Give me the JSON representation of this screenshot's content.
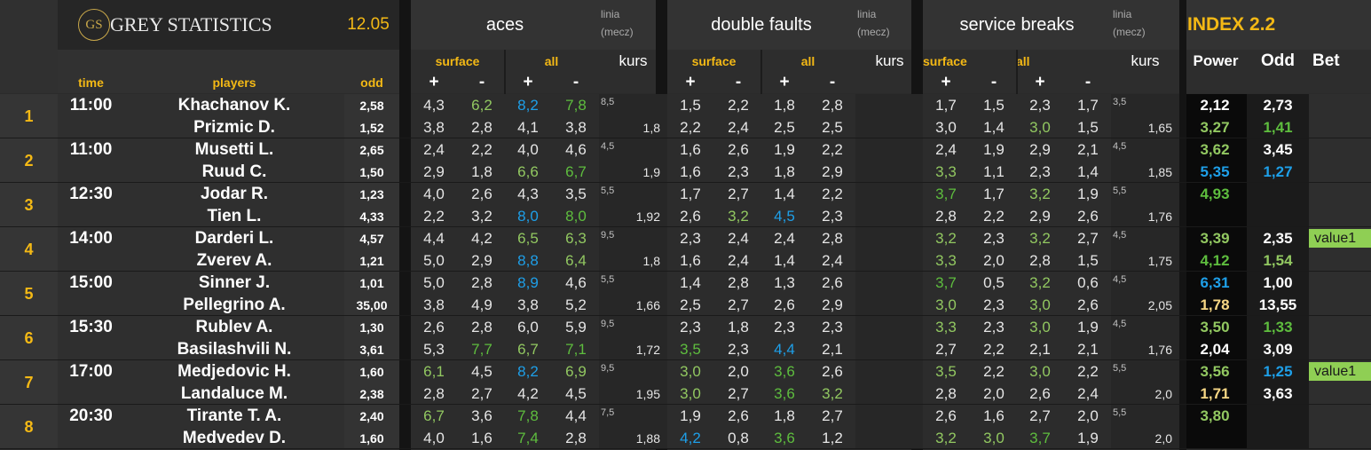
{
  "header": {
    "logo_monogram": "GS",
    "brand": "GREY STATISTICS",
    "date": "12.05",
    "groups": [
      {
        "title": "aces",
        "line_label": "linia\n(mecz)"
      },
      {
        "title": "double faults",
        "line_label": "linia\n(mecz)"
      },
      {
        "title": "service breaks",
        "line_label": "linia\n(mecz)"
      }
    ],
    "index_title": "INDEX 2.2",
    "sub_surface": "surface",
    "sub_all": "all",
    "kurs": "kurs",
    "plus": "+",
    "minus": "-",
    "col_time": "time",
    "col_players": "players",
    "col_odd": "odd",
    "col_power": "Power",
    "col_odd2": "Odd",
    "col_bet": "Bet"
  },
  "matches": [
    {
      "num": "1",
      "time": "11:00",
      "players": [
        {
          "name": "Khachanov K.",
          "odd": "2,58",
          "aces": [
            "4,3",
            "6,2",
            "8,2",
            "7,8"
          ],
          "aces_c": [
            "",
            "g2",
            "bl",
            "g1"
          ],
          "ak": "8,5",
          "df": [
            "1,5",
            "2,2",
            "1,8",
            "2,8"
          ],
          "df_c": [
            "",
            "",
            "",
            ""
          ],
          "dk": "",
          "sb": [
            "1,7",
            "1,5",
            "2,3",
            "1,7"
          ],
          "sb_c": [
            "",
            "",
            "",
            ""
          ],
          "sk": "3,5",
          "power": "2,12",
          "power_c": "white",
          "odd2": "2,73",
          "odd2_c": "white",
          "bet": ""
        },
        {
          "name": "Prizmic D.",
          "odd": "1,52",
          "aces": [
            "3,8",
            "2,8",
            "4,1",
            "3,8"
          ],
          "aces_c": [
            "",
            "",
            "",
            ""
          ],
          "ak": "1,8",
          "df": [
            "2,2",
            "2,4",
            "2,5",
            "2,5"
          ],
          "df_c": [
            "",
            "",
            "",
            ""
          ],
          "dk": "",
          "sb": [
            "3,0",
            "1,4",
            "3,0",
            "1,5"
          ],
          "sb_c": [
            "",
            "",
            "g2",
            ""
          ],
          "sk": "1,65",
          "power": "3,27",
          "power_c": "g2",
          "odd2": "1,41",
          "odd2_c": "g1",
          "bet": ""
        }
      ]
    },
    {
      "num": "2",
      "time": "11:00",
      "players": [
        {
          "name": "Musetti L.",
          "odd": "2,65",
          "aces": [
            "2,4",
            "2,2",
            "4,0",
            "4,6"
          ],
          "aces_c": [
            "",
            "",
            "",
            ""
          ],
          "ak": "4,5",
          "df": [
            "1,6",
            "2,6",
            "1,9",
            "2,2"
          ],
          "df_c": [
            "",
            "",
            "",
            ""
          ],
          "dk": "",
          "sb": [
            "2,4",
            "1,9",
            "2,9",
            "2,1"
          ],
          "sb_c": [
            "",
            "",
            "",
            ""
          ],
          "sk": "4,5",
          "power": "3,62",
          "power_c": "g2",
          "odd2": "3,45",
          "odd2_c": "white",
          "bet": ""
        },
        {
          "name": "Ruud C.",
          "odd": "1,50",
          "aces": [
            "2,9",
            "1,8",
            "6,6",
            "6,7"
          ],
          "aces_c": [
            "",
            "",
            "g2",
            "g1"
          ],
          "ak": "1,9",
          "df": [
            "1,6",
            "2,3",
            "1,8",
            "2,9"
          ],
          "df_c": [
            "",
            "",
            "",
            ""
          ],
          "dk": "",
          "sb": [
            "3,3",
            "1,1",
            "2,3",
            "1,4"
          ],
          "sb_c": [
            "g2",
            "",
            "",
            ""
          ],
          "sk": "1,85",
          "power": "5,35",
          "power_c": "bl",
          "odd2": "1,27",
          "odd2_c": "bl",
          "bet": ""
        }
      ]
    },
    {
      "num": "3",
      "time": "12:30",
      "players": [
        {
          "name": "Jodar R.",
          "odd": "1,23",
          "aces": [
            "4,0",
            "2,6",
            "4,3",
            "3,5"
          ],
          "aces_c": [
            "",
            "",
            "",
            ""
          ],
          "ak": "5,5",
          "df": [
            "1,7",
            "2,7",
            "1,4",
            "2,2"
          ],
          "df_c": [
            "",
            "",
            "",
            ""
          ],
          "dk": "",
          "sb": [
            "3,7",
            "1,7",
            "3,2",
            "1,9"
          ],
          "sb_c": [
            "g1",
            "",
            "g2",
            ""
          ],
          "sk": "5,5",
          "power": "4,93",
          "power_c": "g1",
          "odd2": "",
          "odd2_c": "white",
          "bet": ""
        },
        {
          "name": "Tien L.",
          "odd": "4,33",
          "aces": [
            "2,2",
            "3,2",
            "8,0",
            "8,0"
          ],
          "aces_c": [
            "",
            "",
            "bl",
            "g1"
          ],
          "ak": "1,92",
          "df": [
            "2,6",
            "3,2",
            "4,5",
            "2,3"
          ],
          "df_c": [
            "",
            "g2",
            "bl",
            ""
          ],
          "dk": "",
          "sb": [
            "2,8",
            "2,2",
            "2,9",
            "2,6"
          ],
          "sb_c": [
            "",
            "",
            "",
            ""
          ],
          "sk": "1,76",
          "power": "",
          "power_c": "white",
          "odd2": "",
          "odd2_c": "white",
          "bet": ""
        }
      ]
    },
    {
      "num": "4",
      "time": "14:00",
      "players": [
        {
          "name": "Darderi L.",
          "odd": "4,57",
          "aces": [
            "4,4",
            "4,2",
            "6,5",
            "6,3"
          ],
          "aces_c": [
            "",
            "",
            "g2",
            "g2"
          ],
          "ak": "9,5",
          "df": [
            "2,3",
            "2,4",
            "2,4",
            "2,8"
          ],
          "df_c": [
            "",
            "",
            "",
            ""
          ],
          "dk": "",
          "sb": [
            "3,2",
            "2,3",
            "3,2",
            "2,7"
          ],
          "sb_c": [
            "g2",
            "",
            "g2",
            ""
          ],
          "sk": "4,5",
          "power": "3,39",
          "power_c": "g2",
          "odd2": "2,35",
          "odd2_c": "white",
          "bet": "value1"
        },
        {
          "name": "Zverev A.",
          "odd": "1,21",
          "aces": [
            "5,0",
            "2,9",
            "8,8",
            "6,4"
          ],
          "aces_c": [
            "",
            "",
            "bl",
            "g2"
          ],
          "ak": "1,8",
          "df": [
            "1,6",
            "2,4",
            "1,4",
            "2,4"
          ],
          "df_c": [
            "",
            "",
            "",
            ""
          ],
          "dk": "",
          "sb": [
            "3,3",
            "2,0",
            "2,8",
            "1,5"
          ],
          "sb_c": [
            "g2",
            "",
            "",
            ""
          ],
          "sk": "1,75",
          "power": "4,12",
          "power_c": "g1",
          "odd2": "1,54",
          "odd2_c": "g2",
          "bet": ""
        }
      ]
    },
    {
      "num": "5",
      "time": "15:00",
      "players": [
        {
          "name": "Sinner J.",
          "odd": "1,01",
          "aces": [
            "5,0",
            "2,8",
            "8,9",
            "4,6"
          ],
          "aces_c": [
            "",
            "",
            "bl",
            ""
          ],
          "ak": "5,5",
          "df": [
            "1,4",
            "2,8",
            "1,3",
            "2,6"
          ],
          "df_c": [
            "",
            "",
            "",
            ""
          ],
          "dk": "",
          "sb": [
            "3,7",
            "0,5",
            "3,2",
            "0,6"
          ],
          "sb_c": [
            "g1",
            "",
            "g2",
            ""
          ],
          "sk": "4,5",
          "power": "6,31",
          "power_c": "bl",
          "odd2": "1,00",
          "odd2_c": "white",
          "bet": ""
        },
        {
          "name": "Pellegrino A.",
          "odd": "35,00",
          "aces": [
            "3,8",
            "4,9",
            "3,8",
            "5,2"
          ],
          "aces_c": [
            "",
            "",
            "",
            ""
          ],
          "ak": "1,66",
          "df": [
            "2,5",
            "2,7",
            "2,6",
            "2,9"
          ],
          "df_c": [
            "",
            "",
            "",
            ""
          ],
          "dk": "",
          "sb": [
            "3,0",
            "2,3",
            "3,0",
            "2,6"
          ],
          "sb_c": [
            "g2",
            "",
            "g2",
            ""
          ],
          "sk": "2,05",
          "power": "1,78",
          "power_c": "yl",
          "odd2": "13,55",
          "odd2_c": "white",
          "bet": ""
        }
      ]
    },
    {
      "num": "6",
      "time": "15:30",
      "players": [
        {
          "name": "Rublev A.",
          "odd": "1,30",
          "aces": [
            "2,6",
            "2,8",
            "6,0",
            "5,9"
          ],
          "aces_c": [
            "",
            "",
            "",
            ""
          ],
          "ak": "9,5",
          "df": [
            "2,3",
            "1,8",
            "2,3",
            "2,3"
          ],
          "df_c": [
            "",
            "",
            "",
            ""
          ],
          "dk": "",
          "sb": [
            "3,3",
            "2,3",
            "3,0",
            "1,9"
          ],
          "sb_c": [
            "g2",
            "",
            "g2",
            ""
          ],
          "sk": "4,5",
          "power": "3,50",
          "power_c": "g2",
          "odd2": "1,33",
          "odd2_c": "g1",
          "bet": ""
        },
        {
          "name": "Basilashvili N.",
          "odd": "3,61",
          "aces": [
            "5,3",
            "7,7",
            "6,7",
            "7,1"
          ],
          "aces_c": [
            "",
            "g1",
            "g2",
            "g1"
          ],
          "ak": "1,72",
          "df": [
            "3,5",
            "2,3",
            "4,4",
            "2,1"
          ],
          "df_c": [
            "g1",
            "",
            "bl",
            ""
          ],
          "dk": "",
          "sb": [
            "2,7",
            "2,2",
            "2,1",
            "2,1"
          ],
          "sb_c": [
            "",
            "",
            "",
            ""
          ],
          "sk": "1,76",
          "power": "2,04",
          "power_c": "white",
          "odd2": "3,09",
          "odd2_c": "white",
          "bet": ""
        }
      ]
    },
    {
      "num": "7",
      "time": "17:00",
      "players": [
        {
          "name": "Medjedovic H.",
          "odd": "1,60",
          "aces": [
            "6,1",
            "4,5",
            "8,2",
            "6,9"
          ],
          "aces_c": [
            "g2",
            "",
            "bl",
            "g2"
          ],
          "ak": "9,5",
          "df": [
            "3,0",
            "2,0",
            "3,6",
            "2,6"
          ],
          "df_c": [
            "g2",
            "",
            "g1",
            ""
          ],
          "dk": "",
          "sb": [
            "3,5",
            "2,2",
            "3,0",
            "2,2"
          ],
          "sb_c": [
            "g2",
            "",
            "g2",
            ""
          ],
          "sk": "5,5",
          "power": "3,56",
          "power_c": "g2",
          "odd2": "1,25",
          "odd2_c": "bl",
          "bet": "value1"
        },
        {
          "name": "Landaluce M.",
          "odd": "2,38",
          "aces": [
            "2,8",
            "2,7",
            "4,2",
            "4,5"
          ],
          "aces_c": [
            "",
            "",
            "",
            ""
          ],
          "ak": "1,95",
          "df": [
            "3,0",
            "2,7",
            "3,6",
            "3,2"
          ],
          "df_c": [
            "g2",
            "",
            "g1",
            "g2"
          ],
          "dk": "",
          "sb": [
            "2,8",
            "2,0",
            "2,6",
            "2,4"
          ],
          "sb_c": [
            "",
            "",
            "",
            ""
          ],
          "sk": "2,0",
          "power": "1,71",
          "power_c": "yl",
          "odd2": "3,63",
          "odd2_c": "white",
          "bet": ""
        }
      ]
    },
    {
      "num": "8",
      "time": "20:30",
      "players": [
        {
          "name": "Tirante T. A.",
          "odd": "2,40",
          "aces": [
            "6,7",
            "3,6",
            "7,8",
            "4,4"
          ],
          "aces_c": [
            "g2",
            "",
            "g1",
            ""
          ],
          "ak": "7,5",
          "df": [
            "1,9",
            "2,6",
            "1,8",
            "2,7"
          ],
          "df_c": [
            "",
            "",
            "",
            ""
          ],
          "dk": "",
          "sb": [
            "2,6",
            "1,6",
            "2,7",
            "2,0"
          ],
          "sb_c": [
            "",
            "",
            "",
            ""
          ],
          "sk": "5,5",
          "power": "3,80",
          "power_c": "g2",
          "odd2": "",
          "odd2_c": "white",
          "bet": ""
        },
        {
          "name": "Medvedev D.",
          "odd": "1,60",
          "aces": [
            "4,0",
            "1,6",
            "7,4",
            "2,8"
          ],
          "aces_c": [
            "",
            "",
            "g1",
            ""
          ],
          "ak": "1,88",
          "df": [
            "4,2",
            "0,8",
            "3,6",
            "1,2"
          ],
          "df_c": [
            "bl",
            "",
            "g1",
            ""
          ],
          "dk": "",
          "sb": [
            "3,2",
            "3,0",
            "3,7",
            "1,9"
          ],
          "sb_c": [
            "g2",
            "g2",
            "g1",
            ""
          ],
          "sk": "2,0",
          "power": "",
          "power_c": "white",
          "odd2": "",
          "odd2_c": "white",
          "bet": ""
        }
      ]
    }
  ]
}
